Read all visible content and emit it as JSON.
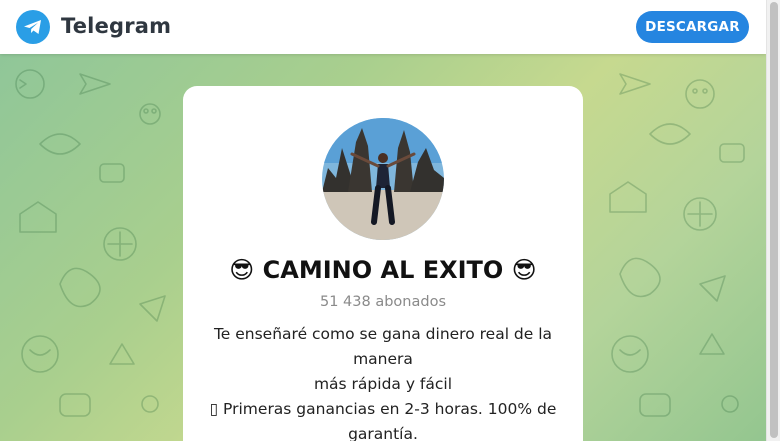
{
  "header": {
    "app_name": "Telegram",
    "download_label": "DESCARGAR"
  },
  "channel": {
    "title": "😎 CAMINO AL EXITO 😎",
    "subscribers": "51 438 abonados",
    "description_lines": [
      "Te enseñaré como se gana dinero real de la manera",
      "más rápida y fácil",
      "▯ Primeras ganancias en 2-3 horas. 100% de",
      "garantía."
    ]
  },
  "colors": {
    "brand": "#2a9ee6",
    "button": "#2585e0",
    "background_pattern": "green-yellow"
  },
  "icons": {
    "logo": "telegram-paper-plane-icon"
  }
}
